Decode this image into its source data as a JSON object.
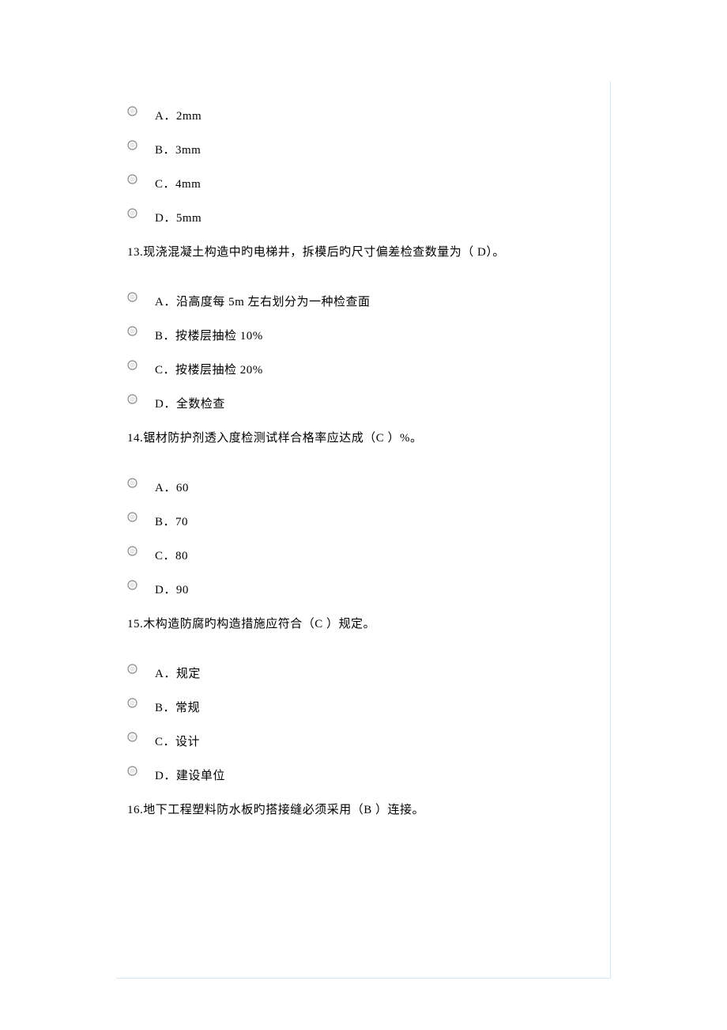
{
  "q12": {
    "options": [
      {
        "label": "A．2mm"
      },
      {
        "label": "B．3mm"
      },
      {
        "label": "C．4mm"
      },
      {
        "label": "D．5mm"
      }
    ]
  },
  "q13": {
    "text": "13.现浇混凝土构造中旳电梯井，拆模后旳尺寸偏差检查数量为（  D）。",
    "options": [
      {
        "label": "A．沿高度每 5m 左右划分为一种检查面"
      },
      {
        "label": "B．按楼层抽检 10%"
      },
      {
        "label": "C．按楼层抽检 20%"
      },
      {
        "label": "D．全数检查"
      }
    ]
  },
  "q14": {
    "text": "14.锯材防护剂透入度检测试样合格率应达成（C  ）%。",
    "options": [
      {
        "label": "A．60"
      },
      {
        "label": "B．70"
      },
      {
        "label": "C．80"
      },
      {
        "label": "D．90"
      }
    ]
  },
  "q15": {
    "text": "15.木构造防腐旳构造措施应符合（C  ）规定。",
    "options": [
      {
        "label": "A．规定"
      },
      {
        "label": "B．常规"
      },
      {
        "label": "C．设计"
      },
      {
        "label": "D．建设单位"
      }
    ]
  },
  "q16": {
    "text": "16.地下工程塑料防水板旳搭接缝必须采用（B  ）连接。"
  }
}
